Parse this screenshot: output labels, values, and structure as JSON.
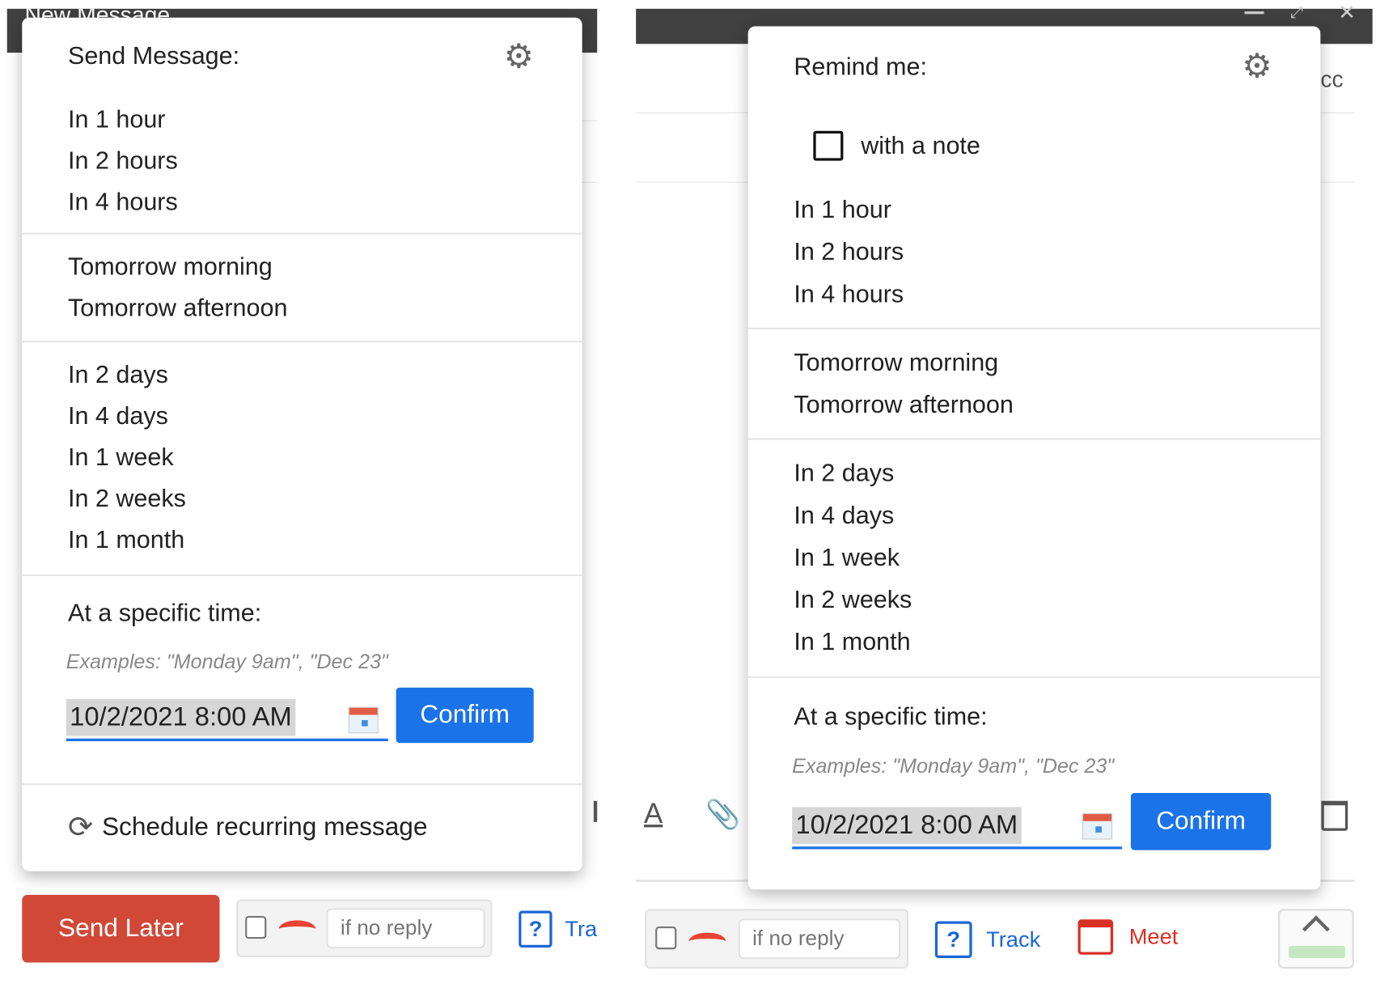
{
  "left": {
    "window_title": "New Message",
    "popup": {
      "title": "Send Message:",
      "groups": [
        [
          "In 1 hour",
          "In 2 hours",
          "In 4 hours"
        ],
        [
          "Tomorrow morning",
          "Tomorrow afternoon"
        ],
        [
          "In 2 days",
          "In 4 days",
          "In 1 week",
          "In 2 weeks",
          "In 1 month"
        ]
      ],
      "specific_label": "At a specific time:",
      "examples": "Examples: \"Monday 9am\", \"Dec 23\"",
      "date_value": "10/2/2021 8:00 AM",
      "confirm": "Confirm",
      "recurring": "Schedule recurring message"
    },
    "toolbar": {
      "send_later": "Send Later",
      "if_no_reply_placeholder": "if no reply",
      "track": "Tra"
    }
  },
  "right": {
    "cc": "cc",
    "popup": {
      "title": "Remind me:",
      "note_label": "with a note",
      "note_checked": false,
      "groups": [
        [
          "In 1 hour",
          "In 2 hours",
          "In 4 hours"
        ],
        [
          "Tomorrow morning",
          "Tomorrow afternoon"
        ],
        [
          "In 2 days",
          "In 4 days",
          "In 1 week",
          "In 2 weeks",
          "In 1 month"
        ]
      ],
      "specific_label": "At a specific time:",
      "examples": "Examples: \"Monday 9am\", \"Dec 23\"",
      "date_value": "10/2/2021 8:00 AM",
      "confirm": "Confirm"
    },
    "toolbar": {
      "if_no_reply_placeholder": "if no reply",
      "track": "Track",
      "meet": "Meet"
    }
  },
  "colors": {
    "accent": "#1a73e8",
    "send_later": "#d14836",
    "track": "#1a66d6",
    "meet": "#d93025"
  }
}
